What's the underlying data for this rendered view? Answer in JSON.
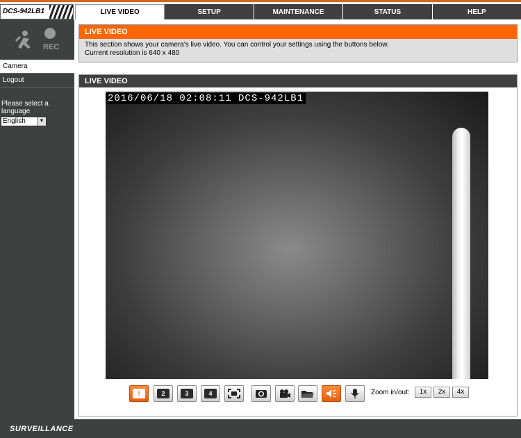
{
  "header": {
    "model": "DCS-942LB1",
    "tabs": [
      {
        "label": "LIVE VIDEO",
        "active": true
      },
      {
        "label": "SETUP",
        "active": false
      },
      {
        "label": "MAINTENANCE",
        "active": false
      },
      {
        "label": "STATUS",
        "active": false
      },
      {
        "label": "HELP",
        "active": false
      }
    ]
  },
  "sidebar": {
    "logo_text": "REC",
    "items": [
      {
        "label": "Camera",
        "active": true
      },
      {
        "label": "Logout",
        "active": false
      }
    ],
    "language_prompt": "Please select a language",
    "language_value": "English"
  },
  "info": {
    "title": "LIVE VIDEO",
    "line1": "This section shows your camera's live video. You can control your settings using the buttons below.",
    "line2": "Current resolution is 640 x 480"
  },
  "live": {
    "title": "LIVE VIDEO",
    "osd": "2016/06/18 02:08:11 DCS-942LB1",
    "controls": [
      {
        "icon": "alert-icon",
        "glyph": "!"
      },
      {
        "icon": "profile-2-icon",
        "glyph": "2"
      },
      {
        "icon": "profile-3-icon",
        "glyph": "3"
      },
      {
        "icon": "profile-4-icon",
        "glyph": "4"
      },
      {
        "icon": "fullscreen-icon",
        "glyph": ""
      },
      {
        "icon": "snapshot-icon",
        "glyph": ""
      },
      {
        "icon": "record-icon",
        "glyph": ""
      },
      {
        "icon": "folder-icon",
        "glyph": ""
      },
      {
        "icon": "speaker-icon",
        "glyph": ""
      },
      {
        "icon": "microphone-icon",
        "glyph": ""
      }
    ],
    "zoom_label": "Zoom in/out:",
    "zoom_levels": [
      "1x",
      "2x",
      "4x"
    ]
  },
  "footer": {
    "brand": "SURVEILLANCE"
  },
  "colors": {
    "accent": "#ff6600",
    "dark": "#404040",
    "sidebar": "#3f4141"
  }
}
